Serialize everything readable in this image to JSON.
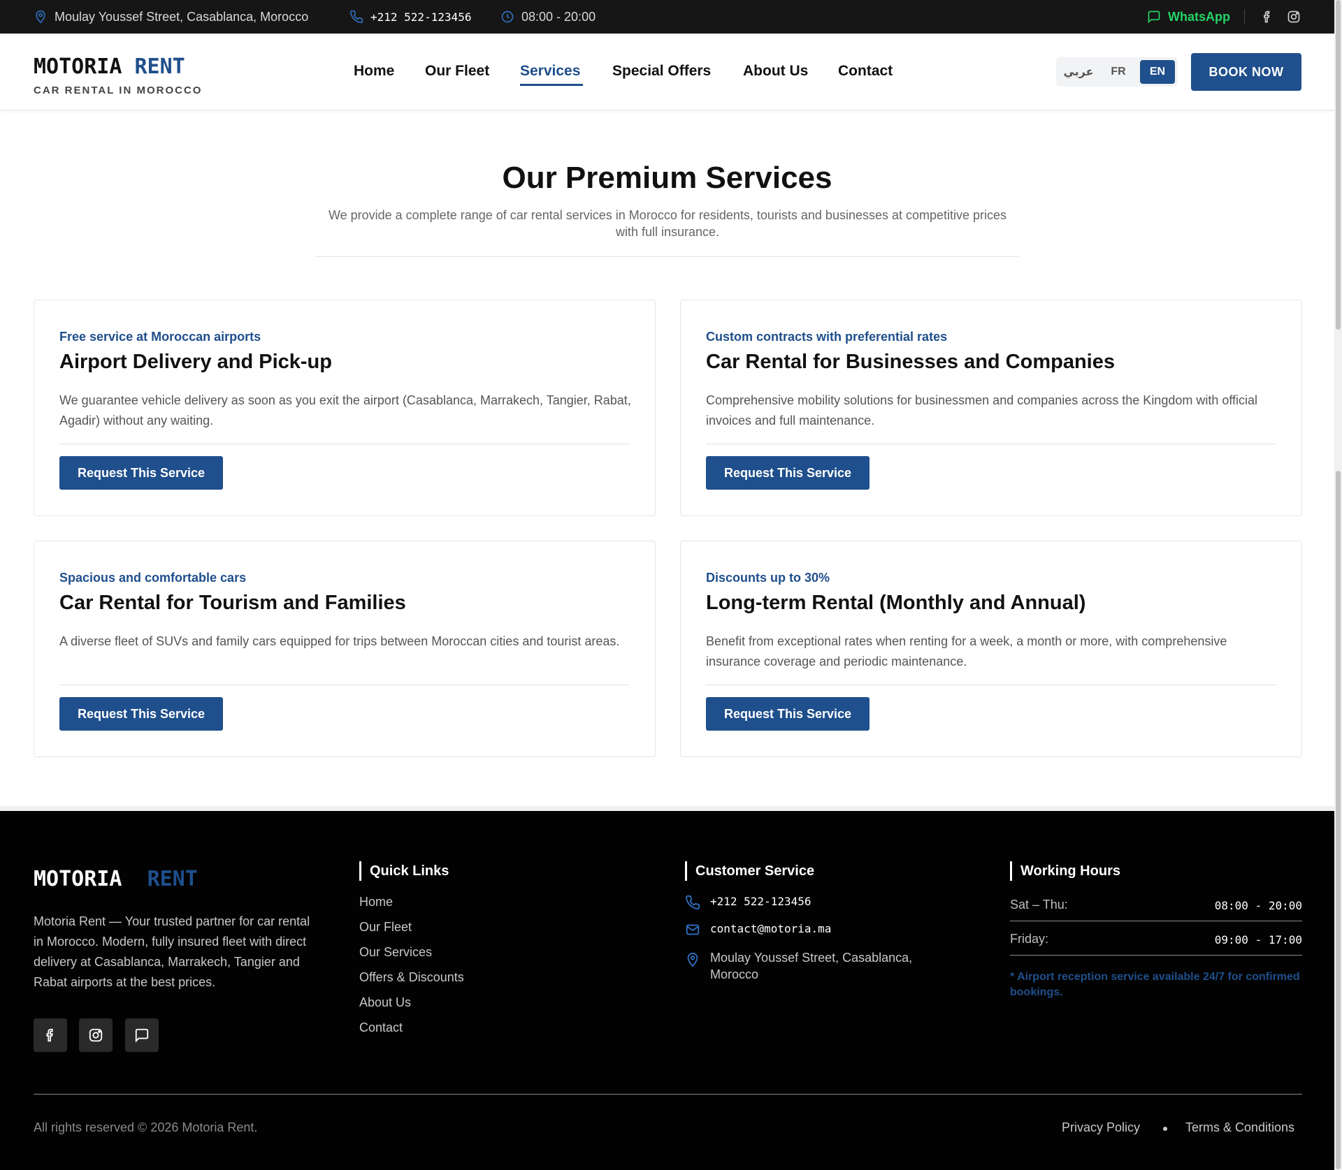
{
  "topbar": {
    "address": "Moulay Youssef Street, Casablanca, Morocco",
    "phone": "+212 522-123456",
    "hours": "08:00 - 20:00",
    "whatsapp": "WhatsApp"
  },
  "header": {
    "logo_main": "MOTORIA",
    "logo_accent": "RENT",
    "tagline": "CAR RENTAL IN MOROCCO",
    "nav": [
      "Home",
      "Our Fleet",
      "Services",
      "Special Offers",
      "About Us",
      "Contact"
    ],
    "active_nav": "Services",
    "languages": [
      "عربي",
      "FR",
      "EN"
    ],
    "active_language": "EN",
    "book_label": "BOOK NOW"
  },
  "section": {
    "title": "Our Premium Services",
    "subtitle": "We provide a complete range of car rental services in Morocco for residents, tourists and businesses at competitive prices with full insurance."
  },
  "services": [
    {
      "eyebrow": "Free service at Moroccan airports",
      "title": "Airport Delivery and Pick-up",
      "description": "We guarantee vehicle delivery as soon as you exit the airport (Casablanca, Marrakech, Tangier, Rabat, Agadir) without any waiting.",
      "button": "Request This Service"
    },
    {
      "eyebrow": "Custom contracts with preferential rates",
      "title": "Car Rental for Businesses and Companies",
      "description": "Comprehensive mobility solutions for businessmen and companies across the Kingdom with official invoices and full maintenance.",
      "button": "Request This Service"
    },
    {
      "eyebrow": "Spacious and comfortable cars",
      "title": "Car Rental for Tourism and Families",
      "description": "A diverse fleet of SUVs and family cars equipped for trips between Moroccan cities and tourist areas.",
      "button": "Request This Service"
    },
    {
      "eyebrow": "Discounts up to 30%",
      "title": "Long-term Rental (Monthly and Annual)",
      "description": "Benefit from exceptional rates when renting for a week, a month or more, with comprehensive insurance coverage and periodic maintenance.",
      "button": "Request This Service"
    }
  ],
  "footer": {
    "logo_main": "MOTORIA",
    "logo_accent": "RENT",
    "about": "Motoria Rent — Your trusted partner for car rental in Morocco. Modern, fully insured fleet with direct delivery at Casablanca, Marrakech, Tangier and Rabat airports at the best prices.",
    "quick_links_title": "Quick Links",
    "quick_links": [
      "Home",
      "Our Fleet",
      "Our Services",
      "Offers & Discounts",
      "About Us",
      "Contact"
    ],
    "customer_service_title": "Customer Service",
    "phone": "+212 522-123456",
    "email": "contact@motoria.ma",
    "address": "Moulay Youssef Street, Casablanca, Morocco",
    "working_hours_title": "Working Hours",
    "hours": [
      {
        "day": "Sat – Thu:",
        "time": "08:00 - 20:00"
      },
      {
        "day": "Friday:",
        "time": "09:00 - 17:00"
      }
    ],
    "hours_note": "* Airport reception service available 24/7 for confirmed bookings.",
    "copyright": "All rights reserved © 2026 Motoria Rent.",
    "privacy": "Privacy Policy",
    "terms": "Terms & Conditions"
  },
  "colors": {
    "brand": "#1f4f8c",
    "topbar_bg": "#161616",
    "footer_bg": "#020202",
    "whatsapp": "#25d366"
  },
  "icons": {
    "address": "map-pin-icon",
    "phone": "phone-icon",
    "hours": "clock-icon",
    "whatsapp": "chat-icon",
    "facebook": "facebook-icon",
    "instagram": "instagram-icon",
    "email": "mail-icon"
  }
}
